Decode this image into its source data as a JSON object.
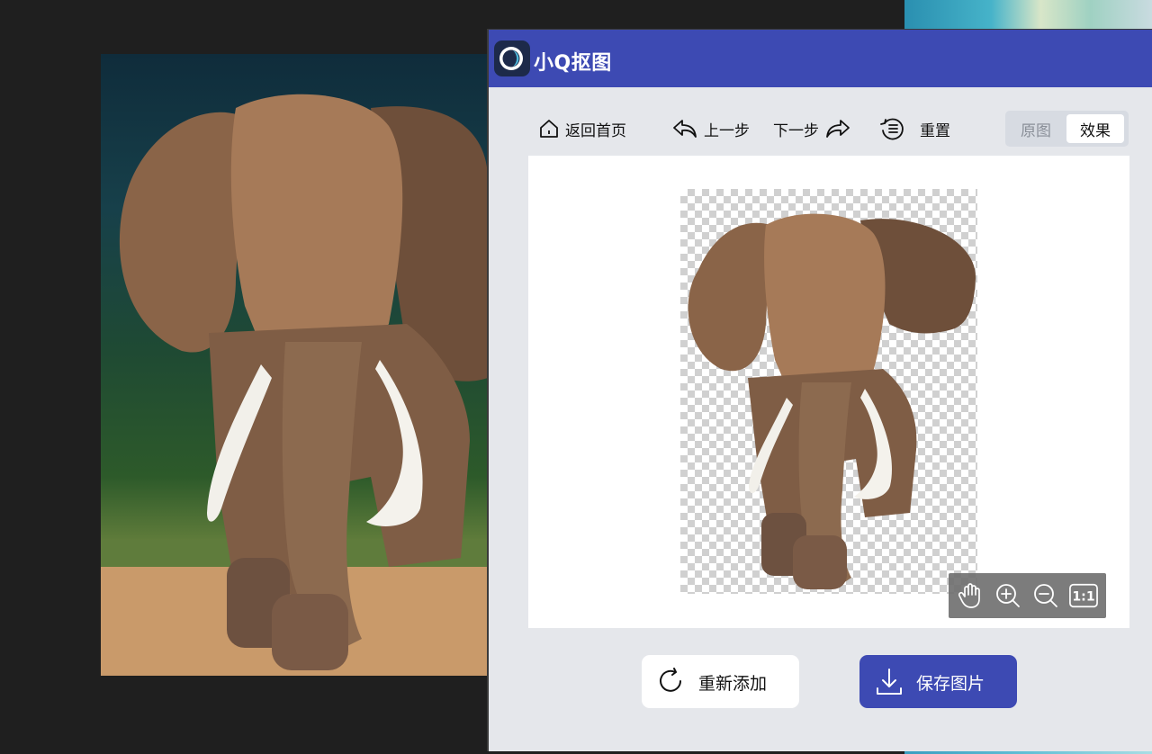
{
  "app": {
    "title": "小Q抠图",
    "accent_color": "#3d4ab3"
  },
  "toolbar": {
    "home_label": "返回首页",
    "undo_label": "上一步",
    "redo_label": "下一步",
    "reset_label": "重置"
  },
  "view_toggle": {
    "original_label": "原图",
    "effect_label": "效果",
    "selected": "效果"
  },
  "zoom_controls": {
    "items": [
      "hand-icon",
      "zoom-in-icon",
      "zoom-out-icon",
      "actual-size-icon"
    ],
    "actual_size_label": "1:1"
  },
  "actions": {
    "readd_label": "重新添加",
    "save_label": "保存图片"
  },
  "icons": {
    "home": "home-icon",
    "undo": "undo-icon",
    "redo": "redo-icon",
    "reset": "reset-icon",
    "readd": "refresh-icon",
    "save": "download-icon"
  }
}
